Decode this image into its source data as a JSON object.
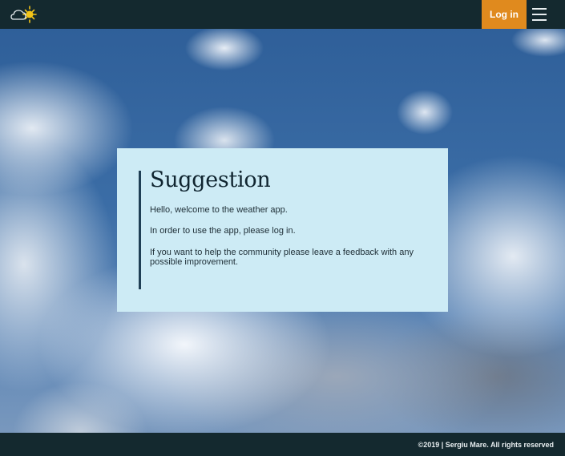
{
  "header": {
    "logo_icon": "cloud-sun-icon",
    "login_label": "Log in",
    "menu_icon": "hamburger-menu-icon",
    "accent_color": "#e08a1e",
    "bar_color": "#14292f"
  },
  "card": {
    "title": "Suggestion",
    "paragraphs": [
      "Hello, welcome to the weather app.",
      "In order to use the app, please log in.",
      "If you want to help the community please leave a feedback with any possible improvement."
    ],
    "background_color": "#cdebf5"
  },
  "footer": {
    "copyright": "©2019 | Sergiu Mare. All rights reserved"
  }
}
